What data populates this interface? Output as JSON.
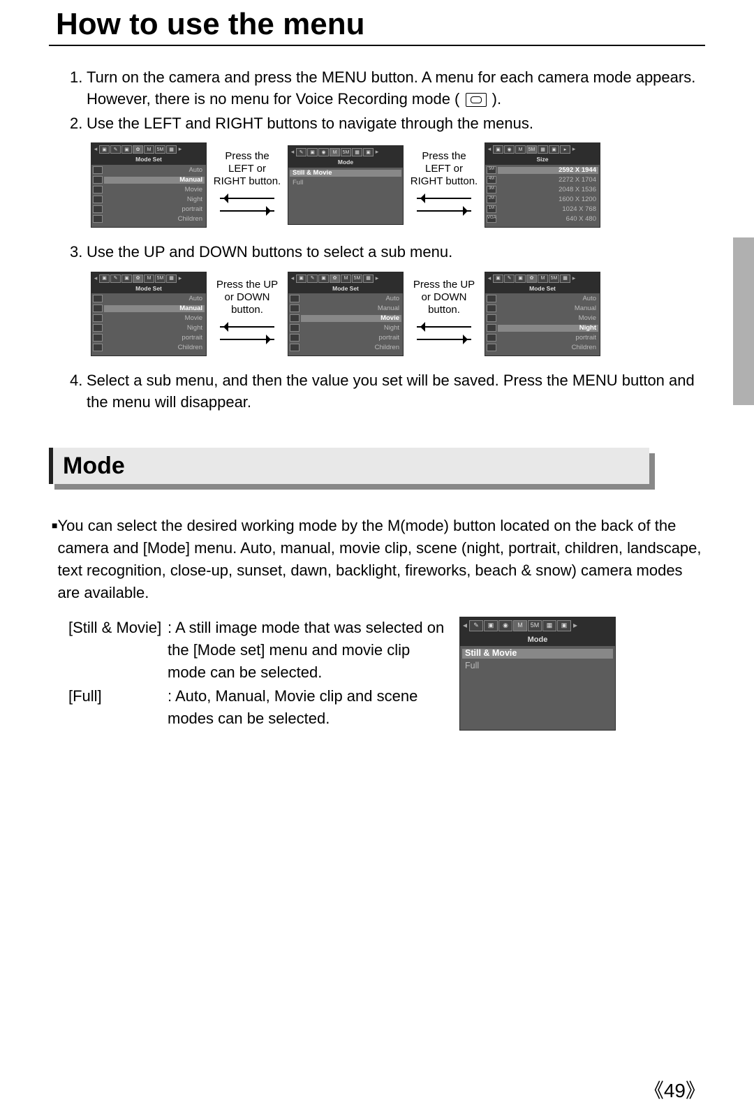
{
  "title": "How to use the menu",
  "steps": {
    "s1": "Turn on the camera and press the MENU button. A menu for each camera mode appears. However, there is no menu for Voice Recording mode (",
    "s1b": ").",
    "s2": "Use the LEFT and RIGHT buttons to navigate through the menus.",
    "s3": "Use the UP and DOWN buttons to select a sub menu.",
    "s4": "Select a sub menu, and then the value you set will be saved. Press the MENU button and the menu will disappear."
  },
  "captions": {
    "lr": "Press the LEFT or RIGHT button.",
    "ud": "Press the UP or DOWN button."
  },
  "screens": {
    "modeSet": {
      "title": "Mode Set",
      "tabs": [
        "▣",
        "✎",
        "▣",
        "✿",
        "M",
        "5M",
        "▦"
      ],
      "items": [
        "Auto",
        "Manual",
        "Movie",
        "Night",
        "portrait",
        "Children"
      ]
    },
    "mode": {
      "title": "Mode",
      "tabs": [
        "✎",
        "▣",
        "◉",
        "M",
        "5M",
        "▦",
        "▣"
      ],
      "items": [
        "Still & Movie",
        "Full"
      ]
    },
    "size": {
      "title": "Size",
      "tabs": [
        "▣",
        "◉",
        "M",
        "5M",
        "▦",
        "▣",
        "▸"
      ],
      "badges": [
        "5M",
        "4M",
        "3M",
        "2M",
        "1M",
        "VGA"
      ],
      "items": [
        "2592 X 1944",
        "2272 X 1704",
        "2048 X 1536",
        "1600 X 1200",
        "1024 X 768",
        "640 X 480"
      ]
    }
  },
  "section2": {
    "heading": "Mode",
    "bullet": "You can select the desired working mode by the M(mode) button located on the back of the camera and [Mode] menu. Auto, manual, movie clip, scene (night, portrait, children, landscape, text recognition, close-up, sunset, dawn, backlight, fireworks, beach & snow) camera modes are available.",
    "defs": [
      {
        "term": "[Still & Movie]",
        "text": ": A still image mode that was selected on the [Mode set] menu and movie clip mode can be selected."
      },
      {
        "term": "[Full]",
        "text": ": Auto, Manual, Movie clip and scene modes can be selected."
      }
    ]
  },
  "pageNumber": "《49》"
}
